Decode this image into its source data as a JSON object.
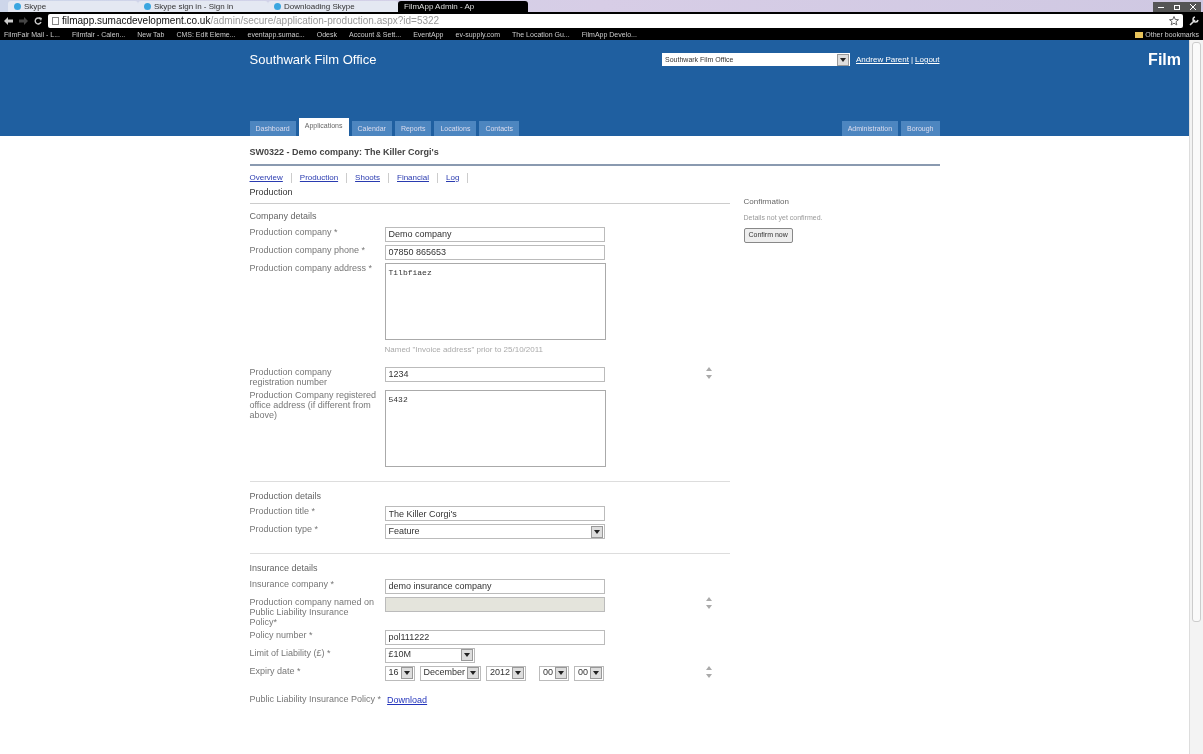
{
  "browser": {
    "tabs": [
      {
        "label": "Skype",
        "selected": false
      },
      {
        "label": "Skype sign in - Sign in",
        "selected": false
      },
      {
        "label": "Downloading Skype",
        "selected": false
      },
      {
        "label": "FilmApp Admin - Ap",
        "selected": true
      }
    ],
    "address": {
      "host": "filmapp.sumacdevelopment.co.uk",
      "path": "/admin/secure/application-production.aspx?id=5322"
    },
    "bookmarks": [
      "FilmFair Mail - L...",
      "Filmfair - Calen...",
      "New Tab",
      "CMS: Edit Eleme...",
      "eventapp.sumac...",
      "Odesk",
      "Account & Sett...",
      "EventApp",
      "ev-supply.com",
      "The Location Gu...",
      "FilmApp Develo..."
    ],
    "other_bookmarks": "Other bookmarks"
  },
  "header": {
    "title": "Southwark Film Office",
    "office_select": "Southwark Film Office",
    "user": "Andrew Parent",
    "separator": "|",
    "logout": "Logout",
    "logo": "Film",
    "nav": [
      {
        "label": "Dashboard",
        "selected": false
      },
      {
        "label": "Applications",
        "selected": true
      },
      {
        "label": "Calendar",
        "selected": false
      },
      {
        "label": "Reports",
        "selected": false
      },
      {
        "label": "Locations",
        "selected": false
      },
      {
        "label": "Contacts",
        "selected": false
      }
    ],
    "nav_right": [
      "Administration",
      "Borough"
    ]
  },
  "page": {
    "title": "SW0322 - Demo company: The Killer Corgi's",
    "subnav": [
      "Overview",
      "Production",
      "Shoots",
      "Financial",
      "Log"
    ],
    "heading": "Production",
    "sections": [
      {
        "title": "Company details",
        "fields": [
          {
            "kind": "text",
            "label": "Production company *",
            "value": "Demo company",
            "disabled": false,
            "spinner": false
          },
          {
            "kind": "text",
            "label": "Production company phone *",
            "value": "07850 865653",
            "disabled": false,
            "spinner": false
          },
          {
            "kind": "textarea",
            "label": "Production company address *",
            "value": "Tilbfiaez",
            "disabled": false,
            "spinner": false,
            "hint": "Named \"Invoice address\" prior to 25/10/2011"
          },
          {
            "kind": "text",
            "label": "Production company registration number",
            "value": "1234",
            "disabled": false,
            "spinner": true
          },
          {
            "kind": "textarea",
            "label": "Production Company registered office address (if different from above)",
            "value": "5432",
            "disabled": false,
            "spinner": false
          }
        ]
      },
      {
        "title": "Production details",
        "fields": [
          {
            "kind": "text",
            "label": "Production title *",
            "value": "The Killer Corgi's",
            "disabled": false,
            "spinner": false
          },
          {
            "kind": "select",
            "label": "Production type *",
            "value": "Feature",
            "disabled": false,
            "spinner": false
          }
        ]
      },
      {
        "title": "Insurance details",
        "fields": [
          {
            "kind": "text",
            "label": "Insurance company *",
            "value": "demo insurance company",
            "disabled": false,
            "spinner": false
          },
          {
            "kind": "text",
            "label": "Production company named on Public Liability Insurance Policy*",
            "disabled": true,
            "spinner": true
          },
          {
            "kind": "text",
            "label": "Policy number *",
            "value": "pol111222",
            "disabled": false,
            "spinner": false
          },
          {
            "kind": "select_small",
            "label": "Limit of Liability (£) *",
            "value": "£10M",
            "disabled": false,
            "spinner": false
          },
          {
            "kind": "date",
            "label": "Expiry date *",
            "parts": [
              "16",
              "December",
              "2012",
              "00",
              "00"
            ],
            "disabled": false,
            "spinner": true
          },
          {
            "kind": "link",
            "label": "Public Liability Insurance Policy *",
            "value": "Download",
            "disabled": false,
            "spinner": false
          }
        ]
      }
    ]
  },
  "confirmation": {
    "title": "Confirmation",
    "text": "Details not yet confirmed.",
    "button": "Confirm now"
  }
}
